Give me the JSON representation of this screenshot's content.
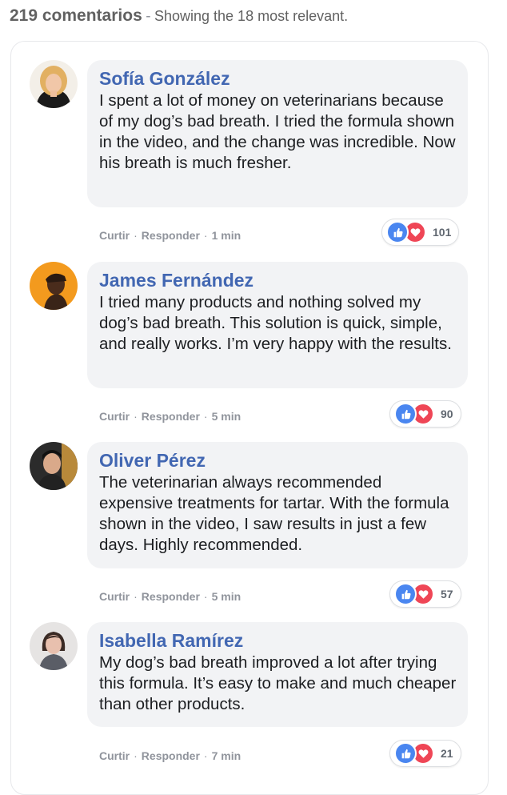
{
  "header": {
    "count": "219 comentarios",
    "separator": "-",
    "subtitle": "Showing the 18 most relevant."
  },
  "actions": {
    "like": "Curtir",
    "reply": "Responder",
    "dot": "·"
  },
  "comments": [
    {
      "name": "Sofía González",
      "text": "I spent a lot of money on veterinarians because of my dog’s bad breath. I tried the formula shown in the video, and the change was incredible. Now his breath is much fresher.",
      "time": "1 min",
      "reactions": "101"
    },
    {
      "name": "James Fernández",
      "text": "I tried many products and nothing solved my dog’s bad breath. This solution is quick, simple, and really works. I’m very happy with the results.",
      "time": "5 min",
      "reactions": "90"
    },
    {
      "name": "Oliver Pérez",
      "text": "The veterinarian always recommended expensive treatments for tartar. With the formula shown in the video, I saw results in just a few days. Highly recommended.",
      "time": "5 min",
      "reactions": "57"
    },
    {
      "name": "Isabella Ramírez",
      "text": "My dog’s bad breath improved a lot after trying this formula. It’s easy to make and much cheaper than other products.",
      "time": "7 min",
      "reactions": "21"
    }
  ],
  "icons": {
    "like": "thumbs-up-icon",
    "love": "heart-icon"
  },
  "colors": {
    "name": "#4267b2",
    "like": "#4a86f0",
    "love": "#ef4656",
    "bubble": "#f2f3f5"
  }
}
